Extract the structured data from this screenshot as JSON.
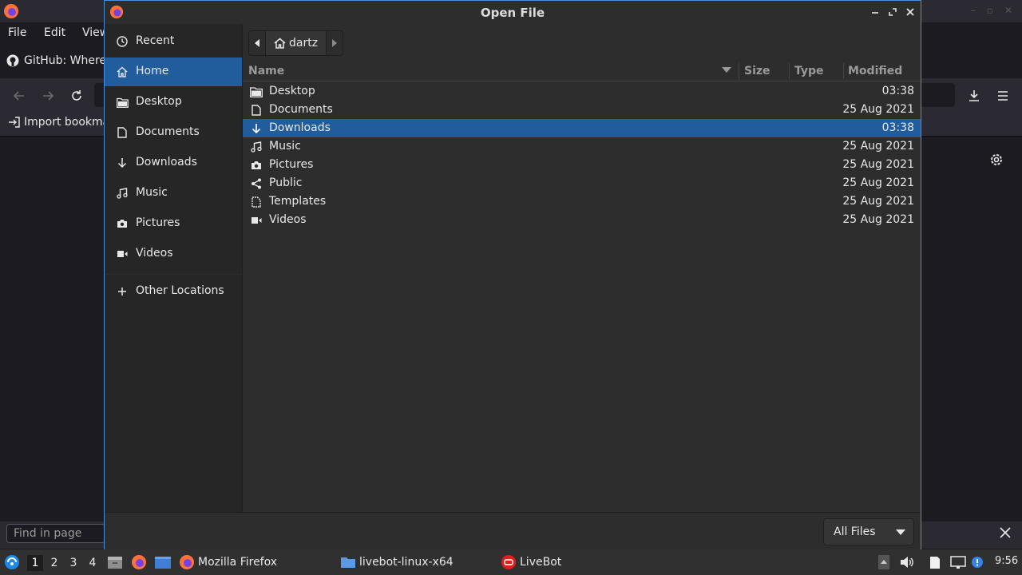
{
  "firefox": {
    "menu": [
      "File",
      "Edit",
      "View"
    ],
    "tab_title": "GitHub: Where",
    "bookmark": "Import bookma",
    "find_placeholder": "Find in page"
  },
  "dialog": {
    "title": "Open File",
    "places": [
      {
        "label": "Recent",
        "icon": "clock-icon"
      },
      {
        "label": "Home",
        "icon": "home-icon",
        "selected": true
      },
      {
        "label": "Desktop",
        "icon": "folder-icon"
      },
      {
        "label": "Documents",
        "icon": "document-icon"
      },
      {
        "label": "Downloads",
        "icon": "download-icon"
      },
      {
        "label": "Music",
        "icon": "music-icon"
      },
      {
        "label": "Pictures",
        "icon": "camera-icon"
      },
      {
        "label": "Videos",
        "icon": "video-icon"
      }
    ],
    "other_locations": "Other Locations",
    "path": "dartz",
    "columns": {
      "name": "Name",
      "size": "Size",
      "type": "Type",
      "modified": "Modified"
    },
    "files": [
      {
        "name": "Desktop",
        "modified": "03:38",
        "icon": "folder-icon"
      },
      {
        "name": "Documents",
        "modified": "25 Aug 2021",
        "icon": "document-icon"
      },
      {
        "name": "Downloads",
        "modified": "03:38",
        "icon": "download-icon",
        "selected": true
      },
      {
        "name": "Music",
        "modified": "25 Aug 2021",
        "icon": "music-icon"
      },
      {
        "name": "Pictures",
        "modified": "25 Aug 2021",
        "icon": "camera-icon"
      },
      {
        "name": "Public",
        "modified": "25 Aug 2021",
        "icon": "share-icon"
      },
      {
        "name": "Templates",
        "modified": "25 Aug 2021",
        "icon": "template-icon"
      },
      {
        "name": "Videos",
        "modified": "25 Aug 2021",
        "icon": "video-icon"
      }
    ],
    "filter": "All Files"
  },
  "taskbar": {
    "workspaces": [
      "1",
      "2",
      "3",
      "4"
    ],
    "active_workspace": "1",
    "windows": [
      "Mozilla Firefox",
      "livebot-linux-x64",
      "LiveBot"
    ],
    "clock": "9:56"
  }
}
